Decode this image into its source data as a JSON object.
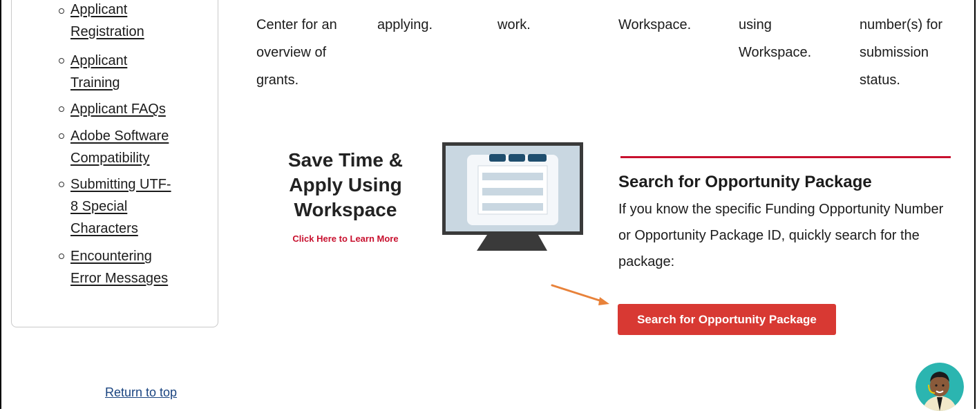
{
  "sidebar": {
    "items": [
      {
        "lines": [
          "Applicant",
          "Registration"
        ]
      },
      {
        "lines": [
          "Applicant",
          "Training"
        ]
      },
      {
        "lines": [
          "Applicant FAQs"
        ]
      },
      {
        "lines": [
          "Adobe Software",
          "Compatibility"
        ]
      },
      {
        "lines": [
          "Submitting UTF-",
          "8 Special",
          "Characters"
        ]
      },
      {
        "lines": [
          "Encountering",
          "Error Messages"
        ]
      }
    ]
  },
  "return_to_top": "Return to top",
  "columns": [
    "Center for an\noverview of\ngrants.",
    "applying.",
    "work.",
    "Workspace.",
    "using\nWorkspace.",
    "number(s) for\nsubmission\nstatus."
  ],
  "promo": {
    "title": "Save Time & Apply Using Workspace",
    "link": "Click Here to Learn More"
  },
  "search": {
    "heading": "Search for Opportunity Package",
    "description": "If you know the specific Funding Opportunity Number or Opportunity Package ID, quickly search for the package:",
    "button_label": "Search for Opportunity Package"
  },
  "colors": {
    "accent_red": "#d83933",
    "rule_red": "#c8102e",
    "arrow_orange": "#e8823a",
    "monitor_screen": "#c9d7e1",
    "monitor_tab": "#1f4e6e"
  },
  "icons": [
    "monitor-illustration",
    "orange-arrow-annotation",
    "chat-assistant-avatar"
  ]
}
